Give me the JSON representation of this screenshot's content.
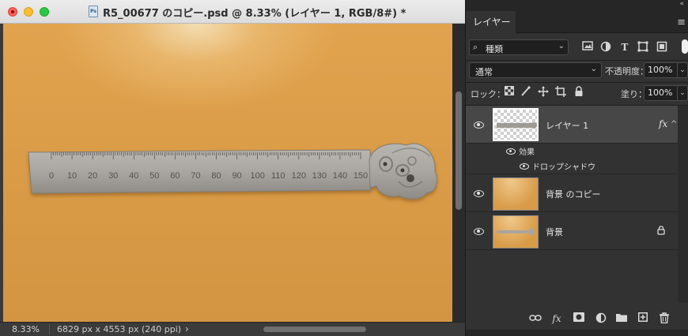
{
  "window": {
    "title": "R5_00677 のコピー.psd @ 8.33% (レイヤー 1, RGB/8#) *",
    "doc_icon": "Ps"
  },
  "status": {
    "zoom": "8.33%",
    "doc_size": "6829 px x 4553 px (240 ppi)",
    "arrow": "›"
  },
  "ruler": {
    "tick_labels": [
      "0",
      "10",
      "20",
      "30",
      "40",
      "50",
      "60",
      "70",
      "80",
      "90",
      "100",
      "110",
      "120",
      "130",
      "140",
      "150"
    ]
  },
  "panel": {
    "collapse": "«",
    "tab": "レイヤー",
    "menu_icon": "≡",
    "filter": {
      "label": "種類",
      "icon": "search-icon"
    },
    "filter_icons": [
      "image-filter-icon",
      "adjustment-filter-icon",
      "type-filter-icon",
      "shape-filter-icon",
      "smart-object-filter-icon"
    ],
    "blend_mode": "通常",
    "opacity_label": "不透明度：",
    "opacity_value": "100%",
    "lock_label": "ロック：",
    "lock_icons": [
      "lock-transparent-icon",
      "lock-image-icon",
      "lock-position-icon",
      "lock-artboard-icon",
      "lock-all-icon"
    ],
    "fill_label": "塗り：",
    "fill_value": "100%"
  },
  "layers": [
    {
      "name": "レイヤー 1",
      "fx": "fx",
      "selected": true,
      "effects_label": "効果",
      "effects": [
        "ドロップシャドウ"
      ]
    },
    {
      "name": "背景 のコピー"
    },
    {
      "name": "背景",
      "locked": true
    }
  ],
  "bottom_icons": [
    "link-layers-icon",
    "fx-icon",
    "mask-icon",
    "adjustment-layer-icon",
    "group-folder-icon",
    "new-layer-icon",
    "trash-icon"
  ],
  "bottom_fx_label": "fx"
}
